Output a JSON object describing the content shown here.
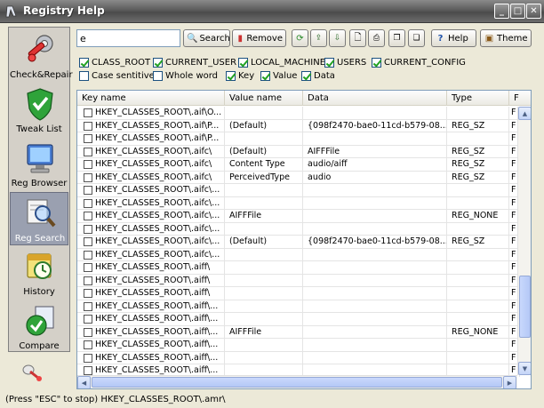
{
  "window": {
    "title": "Registry Help",
    "controls": {
      "minimize": "_",
      "maximize": "□",
      "close": "✕"
    }
  },
  "sidebar": {
    "items": [
      {
        "label": "Check&Repair",
        "icon": "wrench-gear-icon",
        "active": false
      },
      {
        "label": "Tweak List",
        "icon": "shield-check-icon",
        "active": false
      },
      {
        "label": "Reg Browser",
        "icon": "monitor-icon",
        "active": false
      },
      {
        "label": "Reg Search",
        "icon": "magnifier-icon",
        "active": true
      },
      {
        "label": "History",
        "icon": "calendar-clock-icon",
        "active": false
      },
      {
        "label": "Compare",
        "icon": "compare-check-icon",
        "active": false
      }
    ]
  },
  "search": {
    "value": "e",
    "search_label": "Search",
    "remove_label": "Remove",
    "help_label": "Help",
    "theme_label": "Theme"
  },
  "filters": {
    "roots": [
      {
        "label": "CLASS_ROOT",
        "checked": true
      },
      {
        "label": "CURRENT_USER",
        "checked": true
      },
      {
        "label": "LOCAL_MACHINE",
        "checked": true
      },
      {
        "label": "USERS",
        "checked": true
      },
      {
        "label": "CURRENT_CONFIG",
        "checked": true
      }
    ],
    "options": [
      {
        "label": "Case sentitive",
        "checked": false
      },
      {
        "label": "Whole word",
        "checked": false
      },
      {
        "label": "Key",
        "checked": true
      },
      {
        "label": "Value",
        "checked": true
      },
      {
        "label": "Data",
        "checked": true
      }
    ]
  },
  "table": {
    "columns": [
      "Key name",
      "Value name",
      "Data",
      "Type",
      "F"
    ],
    "rows": [
      [
        "HKEY_CLASSES_ROOT\\.aif\\O...",
        "",
        "",
        "",
        "F"
      ],
      [
        "HKEY_CLASSES_ROOT\\.aif\\P...",
        "(Default)",
        "{098f2470-bae0-11cd-b579-08...",
        "REG_SZ",
        "F"
      ],
      [
        "HKEY_CLASSES_ROOT\\.aif\\P...",
        "",
        "",
        "",
        "F"
      ],
      [
        "HKEY_CLASSES_ROOT\\.aifc\\",
        "(Default)",
        "AIFFFile",
        "REG_SZ",
        "F"
      ],
      [
        "HKEY_CLASSES_ROOT\\.aifc\\",
        "Content Type",
        "audio/aiff",
        "REG_SZ",
        "F"
      ],
      [
        "HKEY_CLASSES_ROOT\\.aifc\\",
        "PerceivedType",
        "audio",
        "REG_SZ",
        "F"
      ],
      [
        "HKEY_CLASSES_ROOT\\.aifc\\...",
        "",
        "",
        "",
        "F"
      ],
      [
        "HKEY_CLASSES_ROOT\\.aifc\\...",
        "",
        "",
        "",
        "F"
      ],
      [
        "HKEY_CLASSES_ROOT\\.aifc\\...",
        "AIFFFile",
        "",
        "REG_NONE",
        "F"
      ],
      [
        "HKEY_CLASSES_ROOT\\.aifc\\...",
        "",
        "",
        "",
        "F"
      ],
      [
        "HKEY_CLASSES_ROOT\\.aifc\\...",
        "(Default)",
        "{098f2470-bae0-11cd-b579-08...",
        "REG_SZ",
        "F"
      ],
      [
        "HKEY_CLASSES_ROOT\\.aifc\\...",
        "",
        "",
        "",
        "F"
      ],
      [
        "HKEY_CLASSES_ROOT\\.aiff\\",
        "",
        "",
        "",
        "F"
      ],
      [
        "HKEY_CLASSES_ROOT\\.aiff\\",
        "",
        "",
        "",
        "F"
      ],
      [
        "HKEY_CLASSES_ROOT\\.aiff\\",
        "",
        "",
        "",
        "F"
      ],
      [
        "HKEY_CLASSES_ROOT\\.aiff\\...",
        "",
        "",
        "",
        "F"
      ],
      [
        "HKEY_CLASSES_ROOT\\.aiff\\...",
        "",
        "",
        "",
        "F"
      ],
      [
        "HKEY_CLASSES_ROOT\\.aiff\\...",
        "AIFFFile",
        "",
        "REG_NONE",
        "F"
      ],
      [
        "HKEY_CLASSES_ROOT\\.aiff\\...",
        "",
        "",
        "",
        "F"
      ],
      [
        "HKEY_CLASSES_ROOT\\.aiff\\...",
        "",
        "",
        "",
        "F"
      ],
      [
        "HKEY_CLASSES_ROOT\\.aiff\\...",
        "",
        "",
        "",
        "F"
      ]
    ]
  },
  "status": "(Press \"ESC\" to stop) HKEY_CLASSES_ROOT\\.amr\\"
}
